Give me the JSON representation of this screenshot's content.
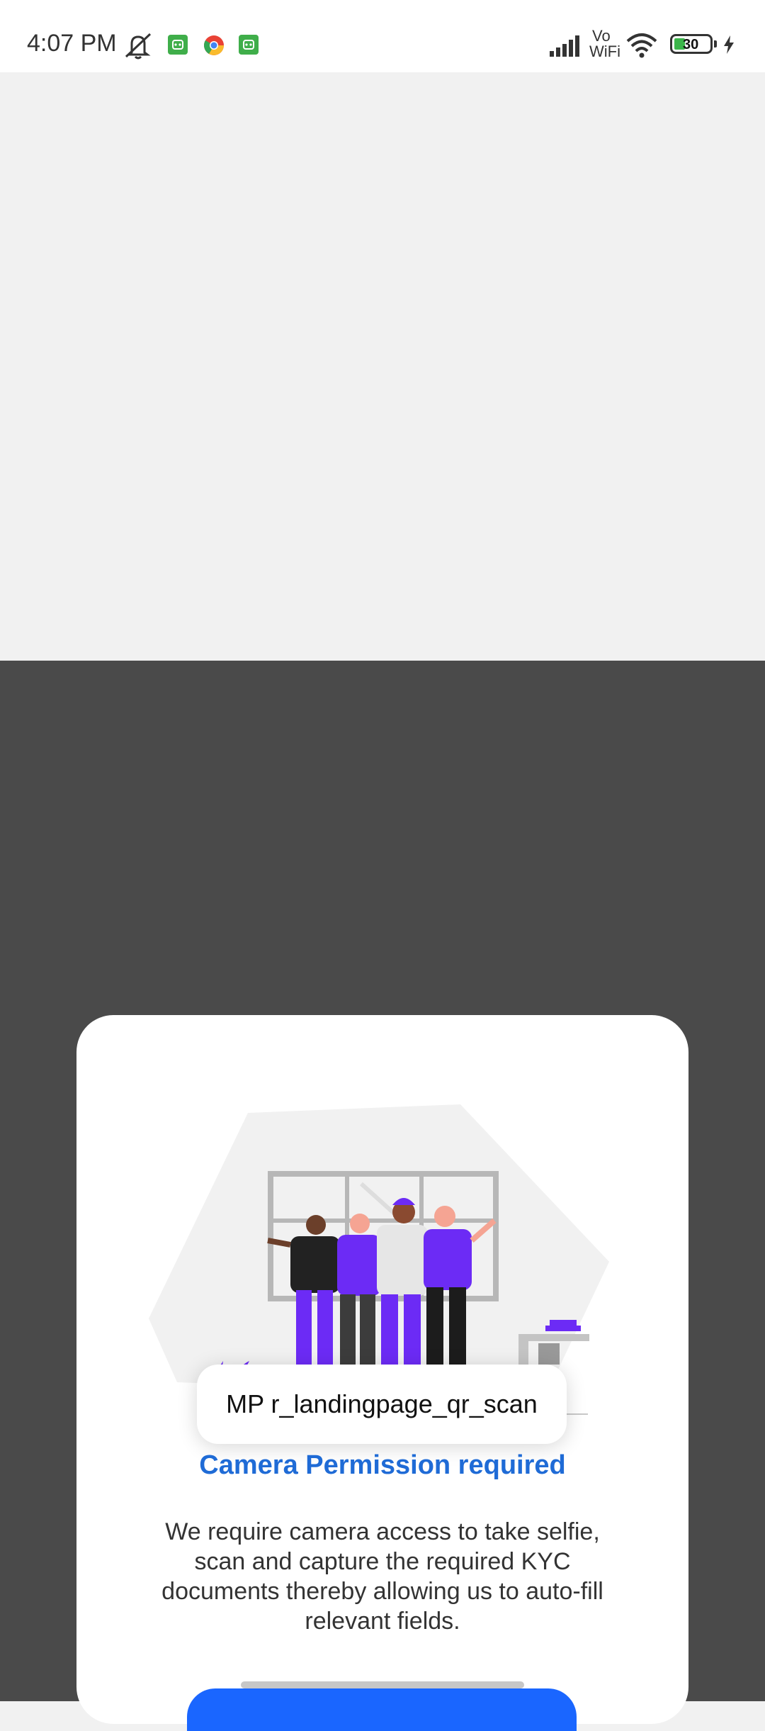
{
  "status_bar": {
    "time": "4:07 PM",
    "battery_level": "30",
    "network_label_top": "Vo",
    "network_label_bottom": "WiFi",
    "icons": [
      "mute-icon",
      "app-notification-icon",
      "chrome-icon",
      "app-notification-icon",
      "signal-icon",
      "wifi-icon",
      "battery-icon",
      "charging-icon"
    ]
  },
  "toast": {
    "text": "MP r_landingpage_qr_scan"
  },
  "permission": {
    "title": "Camera Permission required",
    "description": "We require camera access to take selfie, scan and capture the required KYC documents thereby allowing us to auto-fill relevant fields."
  },
  "colors": {
    "accent": "#1f6bd6",
    "button": "#1a66ff",
    "overlay": "#4a4a4a",
    "illustration_purple": "#6c2bf5"
  }
}
